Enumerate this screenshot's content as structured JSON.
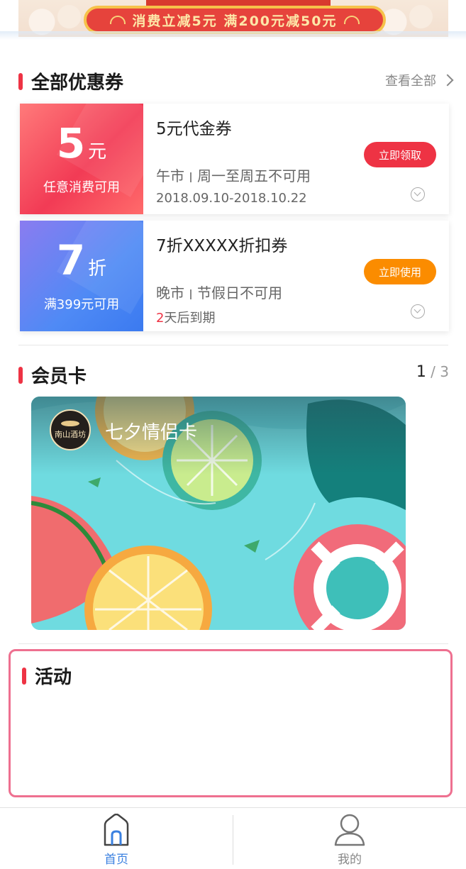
{
  "banner": {
    "text": "消费立减5元  满200元减50元"
  },
  "coupons_section": {
    "title": "全部优惠券",
    "see_all": "查看全部"
  },
  "coupons": [
    {
      "amount": "5",
      "unit": "元",
      "condition": "任意消费可用",
      "title": "5元代金券",
      "period": "午市",
      "restriction": "周一至周五不可用",
      "date_prefix": "",
      "date_text": "2018.09.10-2018.10.22",
      "button": "立即领取",
      "color": "#ee3344"
    },
    {
      "amount": "7",
      "unit": "折",
      "condition": "满399元可用",
      "title": "7折XXXXX折扣券",
      "period": "晚市",
      "restriction": "节假日不可用",
      "date_prefix": "2",
      "date_text": "天后到期",
      "button": "立即使用",
      "color": "#fb8c00"
    }
  ],
  "member_section": {
    "title": "会员卡",
    "page_current": "1",
    "page_total": "/ 3"
  },
  "member_card": {
    "name": "七夕情侣卡",
    "logo_text": "南山酒坊"
  },
  "activity_section": {
    "title": "活动"
  },
  "tabbar": {
    "tabs": [
      {
        "label": "首页",
        "icon": "home-icon",
        "active": true
      },
      {
        "label": "我的",
        "icon": "user-icon",
        "active": false
      }
    ]
  }
}
